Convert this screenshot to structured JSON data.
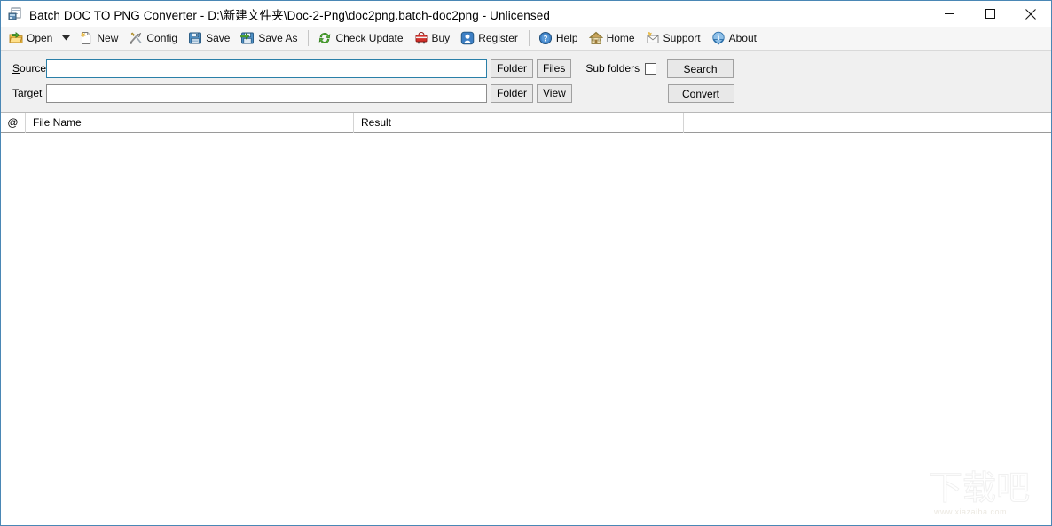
{
  "window": {
    "title": "Batch DOC TO PNG Converter - D:\\新建文件夹\\Doc-2-Png\\doc2png.batch-doc2png - Unlicensed",
    "app_icon": "converter-app-icon",
    "accent_border": "#4a87b5",
    "controls": {
      "minimize": "minimize-icon",
      "maximize": "maximize-icon",
      "close": "close-icon"
    }
  },
  "toolbar": {
    "items": [
      {
        "label": "Open",
        "icon": "open-folder-icon"
      },
      {
        "label": "New",
        "icon": "new-file-icon"
      },
      {
        "label": "Config",
        "icon": "config-tools-icon"
      },
      {
        "label": "Save",
        "icon": "save-floppy-icon"
      },
      {
        "label": "Save As",
        "icon": "save-as-floppy-icon"
      },
      {
        "label": "Check Update",
        "icon": "check-update-refresh-icon"
      },
      {
        "label": "Buy",
        "icon": "buy-cart-icon"
      },
      {
        "label": "Register",
        "icon": "register-key-icon"
      },
      {
        "label": "Help",
        "icon": "help-question-icon"
      },
      {
        "label": "Home",
        "icon": "home-house-icon"
      },
      {
        "label": "Support",
        "icon": "support-envelope-icon"
      },
      {
        "label": "About",
        "icon": "about-info-icon"
      }
    ],
    "open_dropdown_icon": "chevron-down-icon"
  },
  "form": {
    "source": {
      "label_pre": "S",
      "label_accel": "o",
      "label_post": "urce",
      "label_full": "Source",
      "value": "",
      "placeholder": "",
      "folder_button": "Folder",
      "files_button": "Files"
    },
    "target": {
      "label_pre": "",
      "label_accel": "T",
      "label_post": "arget",
      "label_full": "Target",
      "value": "",
      "placeholder": "",
      "folder_button": "Folder",
      "view_button": "View"
    },
    "sub_folders_label": "Sub folders",
    "sub_folders_checked": false,
    "search_button": "Search",
    "convert_button": "Convert"
  },
  "list": {
    "columns": [
      {
        "key": "at",
        "label": "@"
      },
      {
        "key": "name",
        "label": "File Name"
      },
      {
        "key": "result",
        "label": "Result"
      },
      {
        "key": "tail",
        "label": ""
      }
    ],
    "rows": []
  },
  "watermark": {
    "cjk": "下载吧",
    "url": "www.xiazaiba.com"
  }
}
